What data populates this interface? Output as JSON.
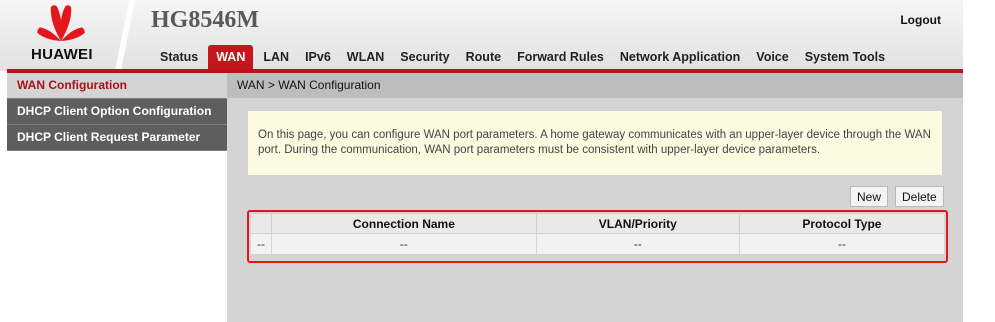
{
  "brand": {
    "logo_text": "HUAWEI",
    "model": "HG8546M",
    "brand_color": "#c4161c"
  },
  "header": {
    "logout_label": "Logout"
  },
  "nav": {
    "items": [
      {
        "label": "Status"
      },
      {
        "label": "WAN"
      },
      {
        "label": "LAN"
      },
      {
        "label": "IPv6"
      },
      {
        "label": "WLAN"
      },
      {
        "label": "Security"
      },
      {
        "label": "Route"
      },
      {
        "label": "Forward Rules"
      },
      {
        "label": "Network Application"
      },
      {
        "label": "Voice"
      },
      {
        "label": "System Tools"
      }
    ],
    "active": "WAN"
  },
  "sidebar": {
    "items": [
      {
        "label": "WAN Configuration"
      },
      {
        "label": "DHCP Client Option Configuration"
      },
      {
        "label": "DHCP Client Request Parameter"
      }
    ],
    "active": "WAN Configuration"
  },
  "main": {
    "breadcrumb": "WAN > WAN Configuration",
    "info_text": "On this page, you can configure WAN port parameters. A home gateway communicates with an upper-layer device through the WAN port. During the communication, WAN port parameters must be consistent with upper-layer device parameters.",
    "buttons": {
      "new_label": "New",
      "delete_label": "Delete"
    },
    "table": {
      "headers": [
        "",
        "Connection Name",
        "VLAN/Priority",
        "Protocol Type"
      ],
      "rows": [
        [
          "--",
          "--",
          "--",
          "--"
        ]
      ]
    }
  }
}
